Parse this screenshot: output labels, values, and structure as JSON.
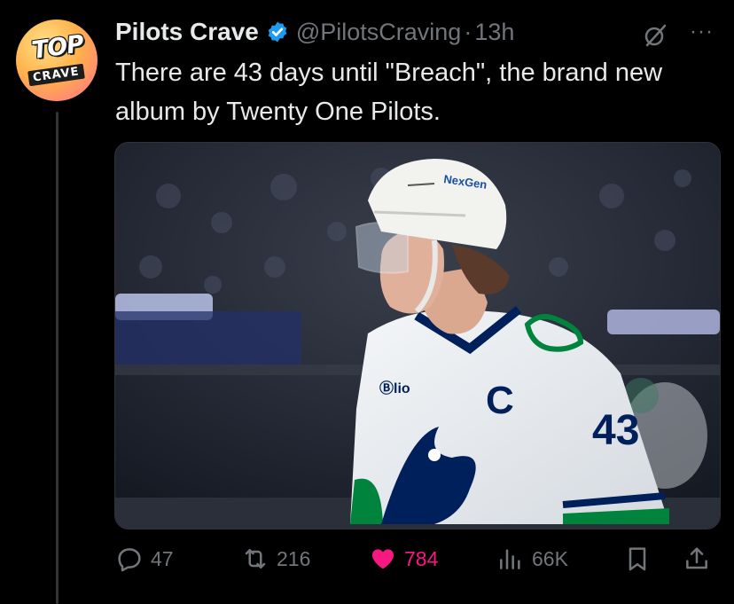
{
  "avatar": {
    "line1": "TOP",
    "line2": "CRAVE"
  },
  "header": {
    "display_name": "Pilots Crave",
    "handle": "@PilotsCraving",
    "separator": "·",
    "time": "13h",
    "more_label": "···"
  },
  "tweet": {
    "text": "There are 43 days until \"Breach\", the brand new album by Twenty One Pilots."
  },
  "media": {
    "helmet_text": "NexGen",
    "jersey_sponsor": "Ⓑlio",
    "captain_letter": "C",
    "jersey_number": "43"
  },
  "actions": {
    "replies": "47",
    "reposts": "216",
    "likes": "784",
    "views": "66K"
  },
  "colors": {
    "background": "#000000",
    "text": "#e7e9ea",
    "muted": "#71767b",
    "verified": "#1d9bf0",
    "like": "#f91880"
  }
}
